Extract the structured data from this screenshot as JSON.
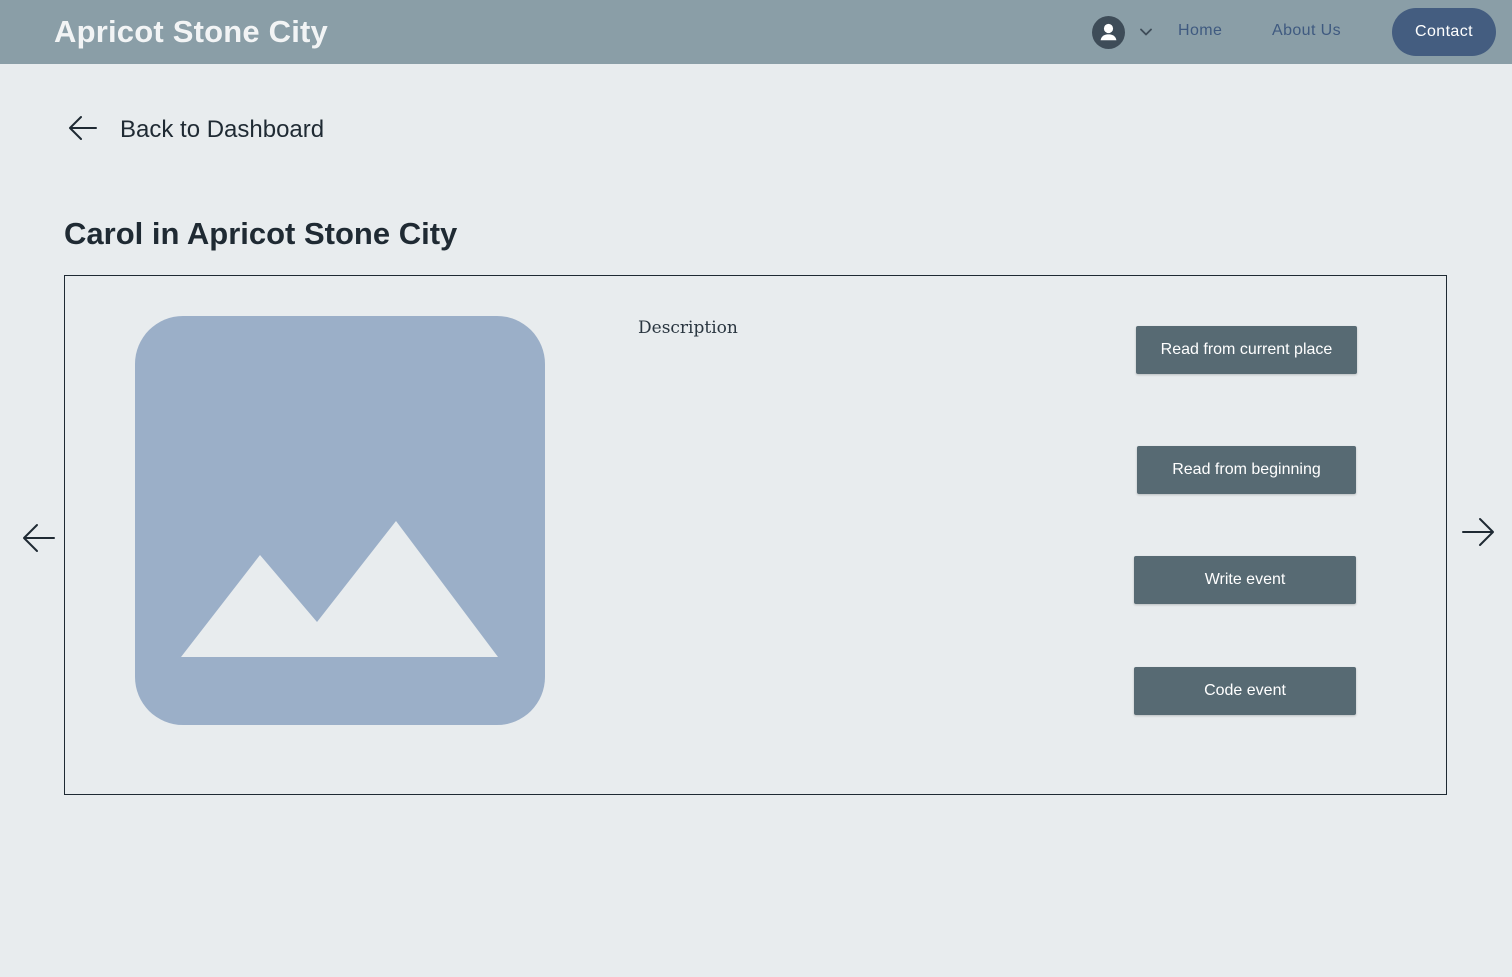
{
  "header": {
    "brand": "Apricot Stone City",
    "nav": {
      "home": "Home",
      "about": "About Us",
      "contact": "Contact"
    },
    "icons": {
      "avatar": "user-avatar-icon",
      "dropdown": "chevron-down-icon"
    }
  },
  "back": {
    "label": "Back to Dashboard",
    "icon": "arrow-left-icon"
  },
  "page": {
    "title": "Carol in Apricot Stone City"
  },
  "card": {
    "image_icon": "image-placeholder-icon",
    "description": "Description",
    "actions": {
      "read_current": "Read from current place",
      "read_beginning": "Read from beginning",
      "write_event": "Write event",
      "code_event": "Code event"
    }
  },
  "carousel": {
    "prev_icon": "arrow-left-icon",
    "next_icon": "arrow-right-icon"
  },
  "colors": {
    "header_bg": "#8a9ea7",
    "page_bg": "#e8ecee",
    "contact_bg": "#445d80",
    "button_bg": "#576a73",
    "image_placeholder": "#9bafc8",
    "nav_link": "#3f5a80"
  }
}
